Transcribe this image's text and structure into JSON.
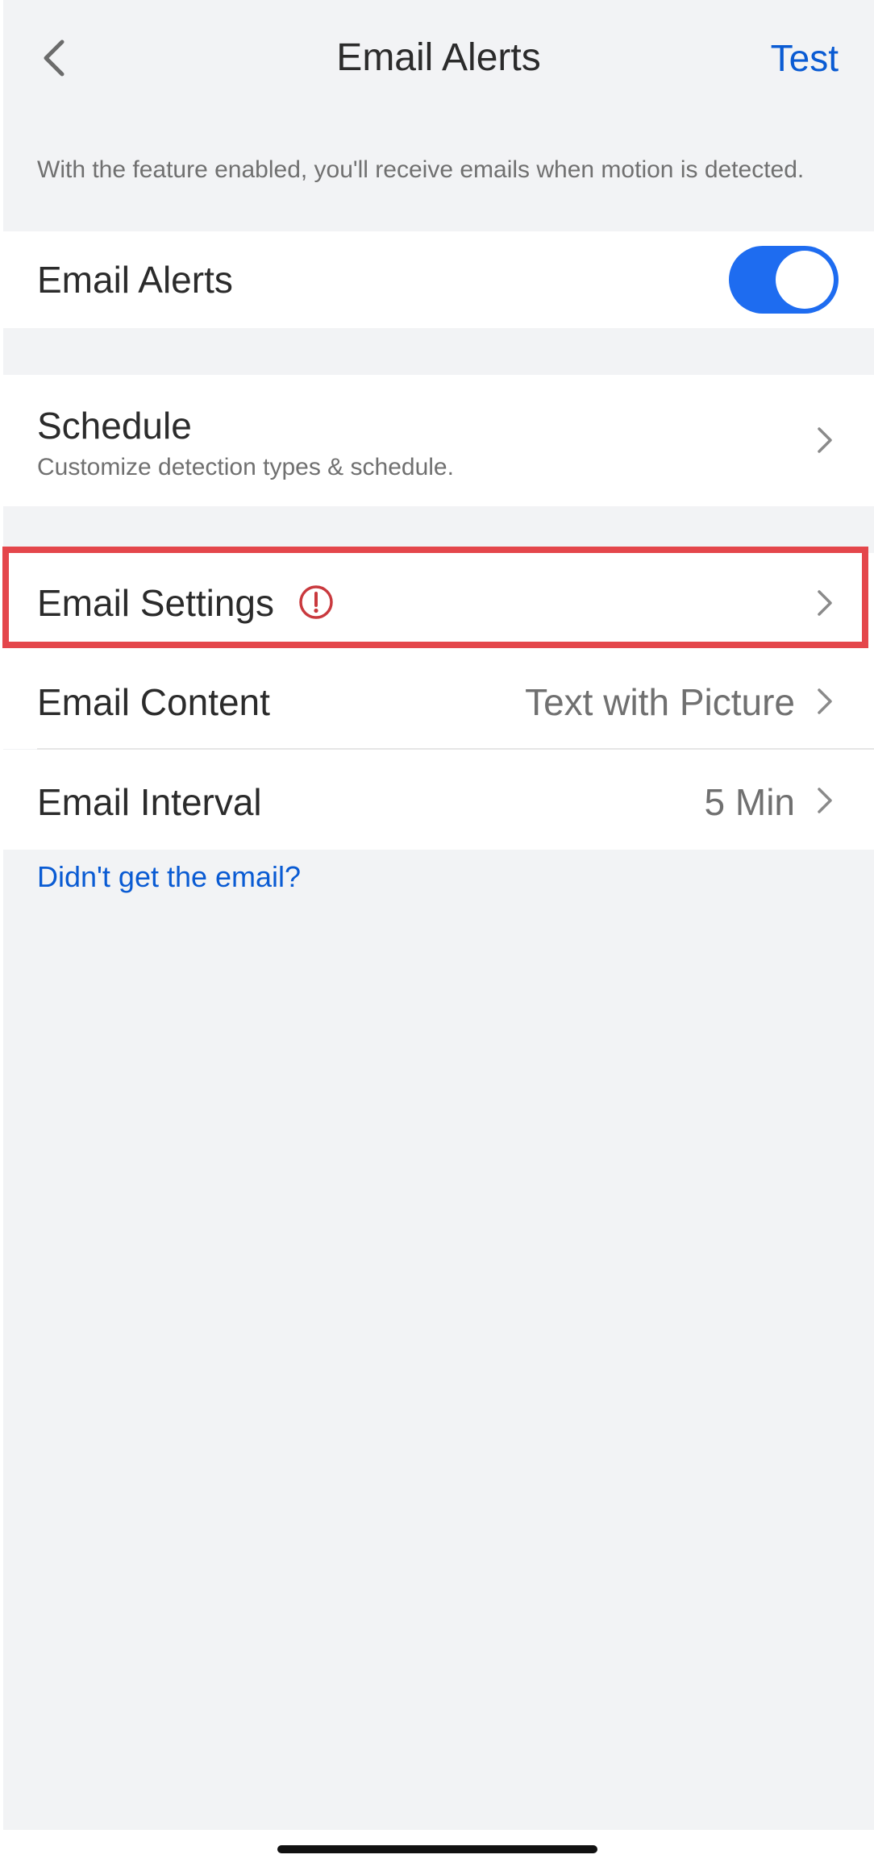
{
  "header": {
    "title": "Email Alerts",
    "test_label": "Test"
  },
  "intro_text": "With the feature enabled, you'll receive emails when motion is detected.",
  "email_alerts_row": {
    "label": "Email Alerts",
    "enabled": true
  },
  "schedule_row": {
    "label": "Schedule",
    "subtitle": "Customize detection types & schedule."
  },
  "email_settings_row": {
    "label": "Email Settings",
    "warning_icon": "exclamation-circle-icon"
  },
  "email_content_row": {
    "label": "Email Content",
    "value": "Text with Picture"
  },
  "email_interval_row": {
    "label": "Email Interval",
    "value": "5 Min"
  },
  "help_link": "Didn't get the email?",
  "colors": {
    "accent": "#0a5bd3",
    "toggle_on": "#1e6cf0",
    "warning": "#c9393e",
    "highlight_border": "#e4464b",
    "background": "#f2f3f5"
  }
}
